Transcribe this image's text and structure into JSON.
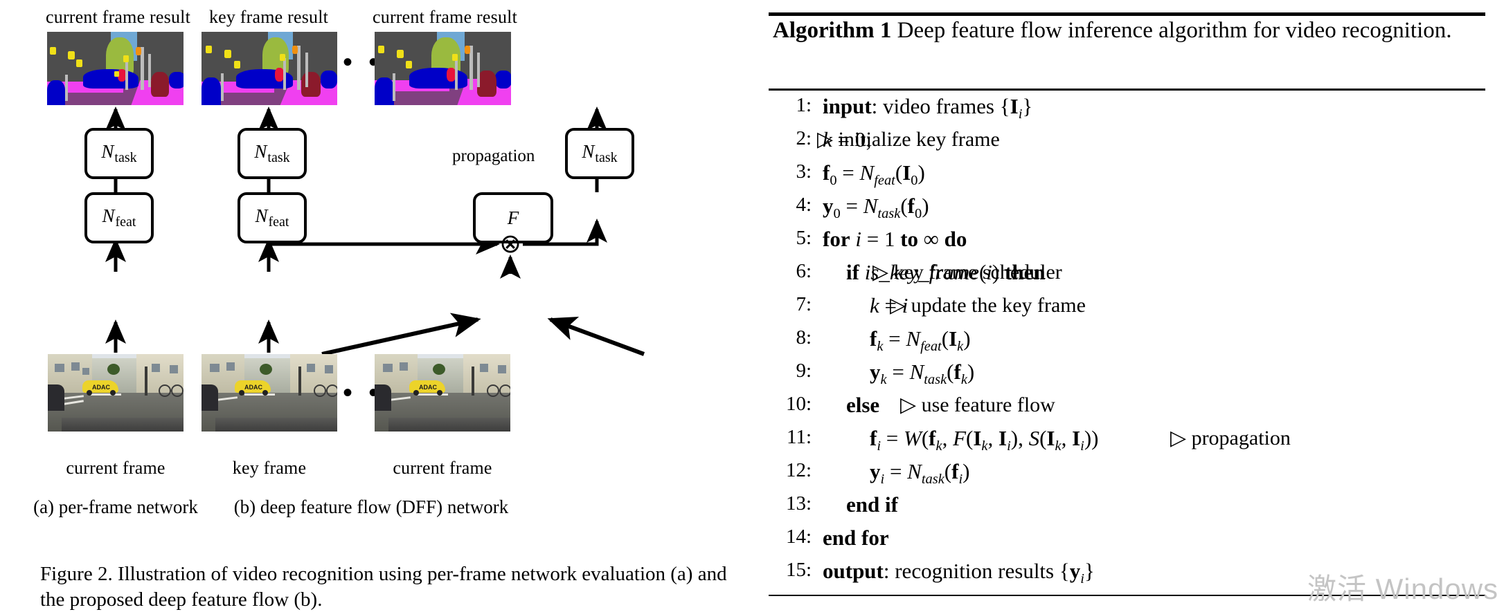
{
  "figure": {
    "top_labels": [
      {
        "text": "current frame result"
      },
      {
        "text": "key frame result"
      },
      {
        "text": "current frame result"
      }
    ],
    "nodes": [
      {
        "name": "N",
        "sub": "task"
      },
      {
        "name": "N",
        "sub": "feat"
      },
      {
        "name": "N",
        "sub": "task"
      },
      {
        "name": "N",
        "sub": "feat"
      },
      {
        "name": "F",
        "sub": ""
      },
      {
        "name": "N",
        "sub": "task"
      }
    ],
    "propagation_label": "propagation",
    "multiply_symbol": "⊗",
    "ellipsis": "• • •",
    "bottom_labels": [
      {
        "text": "current frame"
      },
      {
        "text": "key frame"
      },
      {
        "text": "current frame"
      }
    ],
    "subcaptions": [
      {
        "text": "(a) per-frame network"
      },
      {
        "text": "(b) deep feature flow (DFF) network"
      }
    ],
    "caption": "Figure 2. Illustration of video recognition using per-frame network evaluation (a) and the proposed deep feature flow (b).",
    "photo_car_text": "ADAC",
    "colors": {
      "seg_building": "#4d4d4d",
      "seg_sky": "#6fa8d4",
      "seg_vegetation": "#9aba3f",
      "seg_road": "#804080",
      "seg_sidewalk": "#f040f0",
      "seg_car": "#0000c8",
      "seg_person": "#8b1a2b",
      "seg_rider": "#e8143c",
      "seg_pole": "#bcbcbc",
      "seg_sign": "#f0e018",
      "seg_trafficlight": "#f09010"
    }
  },
  "algorithm": {
    "title_bold": "Algorithm 1",
    "title_rest": "Deep feature flow inference algorithm for video recognition.",
    "lines": [
      {
        "num": "1:",
        "indent": 0,
        "html": "<span class='kw'>input</span>: video frames {<span class='bv'>I</span><sub class='mi'>i</sub>}",
        "comment": ""
      },
      {
        "num": "2:",
        "indent": 0,
        "html": "<span class='mi'>k</span> = 0;",
        "comment": "▷ initialize key frame"
      },
      {
        "num": "3:",
        "indent": 0,
        "html": "<span class='bv'>f</span><sub>0</sub> = <span class='cal'>N</span><sub class='mi'>feat</sub>(<span class='bv'>I</span><sub>0</sub>)",
        "comment": ""
      },
      {
        "num": "4:",
        "indent": 0,
        "html": "<span class='bv'>y</span><sub>0</sub> = <span class='cal'>N</span><sub class='mi'>task</sub>(<span class='bv'>f</span><sub>0</sub>)",
        "comment": ""
      },
      {
        "num": "5:",
        "indent": 0,
        "html": "<span class='kw'>for</span> <span class='mi'>i</span> = 1 <span class='kw'>to</span> ∞ <span class='kw'>do</span>",
        "comment": ""
      },
      {
        "num": "6:",
        "indent": 1,
        "html": "<span class='kw'>if</span> <span class='mi'>is_key_frame</span>(<span class='mi'>i</span>) <span class='kw'>then</span>",
        "comment": "▷ key frame scheduler"
      },
      {
        "num": "7:",
        "indent": 2,
        "html": "<span class='mi'>k</span> = <span class='mi'>i</span>",
        "comment": "▷ update the key frame"
      },
      {
        "num": "8:",
        "indent": 2,
        "html": "<span class='bv'>f</span><sub class='mi'>k</sub> = <span class='cal'>N</span><sub class='mi'>feat</sub>(<span class='bv'>I</span><sub class='mi'>k</sub>)",
        "comment": ""
      },
      {
        "num": "9:",
        "indent": 2,
        "html": "<span class='bv'>y</span><sub class='mi'>k</sub> = <span class='cal'>N</span><sub class='mi'>task</sub>(<span class='bv'>f</span><sub class='mi'>k</sub>)",
        "comment": ""
      },
      {
        "num": "10:",
        "indent": 1,
        "html": "<span class='kw'>else</span>",
        "comment": "▷ use feature flow"
      },
      {
        "num": "11:",
        "indent": 2,
        "html": "<span class='bv'>f</span><sub class='mi'>i</sub> = <span class='cal'>W</span>(<span class='bv'>f</span><sub class='mi'>k</sub>, <span class='cal'>F</span>(<span class='bv'>I</span><sub class='mi'>k</sub>, <span class='bv'>I</span><sub class='mi'>i</sub>), <span class='cal'>S</span>(<span class='bv'>I</span><sub class='mi'>k</sub>, <span class='bv'>I</span><sub class='mi'>i</sub>))",
        "comment": "▷ propagation"
      },
      {
        "num": "12:",
        "indent": 2,
        "html": "<span class='bv'>y</span><sub class='mi'>i</sub> = <span class='cal'>N</span><sub class='mi'>task</sub>(<span class='bv'>f</span><sub class='mi'>i</sub>)",
        "comment": ""
      },
      {
        "num": "13:",
        "indent": 1,
        "html": "<span class='kw'>end if</span>",
        "comment": ""
      },
      {
        "num": "14:",
        "indent": 0,
        "html": "<span class='kw'>end for</span>",
        "comment": ""
      },
      {
        "num": "15:",
        "indent": 0,
        "html": "<span class='kw'>output</span>: recognition results {<span class='bv'>y</span><sub class='mi'>i</sub>}",
        "comment": ""
      }
    ],
    "comment_x": {
      "2": 1180,
      "6": 1260,
      "7": 1285,
      "10": 1300,
      "11": 1690
    }
  },
  "watermark": {
    "text": "激活 Windows"
  }
}
